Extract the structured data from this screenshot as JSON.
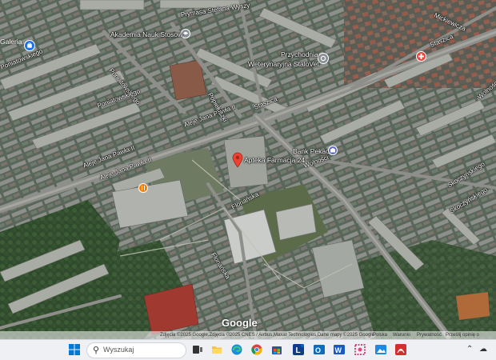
{
  "map": {
    "streets": [
      {
        "id": "aleje-jana-pawla-1",
        "text": "Aleje Jana Pawła II"
      },
      {
        "id": "aleje-jana-pawla-2",
        "text": "Aleje Jana Pawła II"
      },
      {
        "id": "aleje-jana-pawla-3",
        "text": "Aleje Jana Pawła II"
      },
      {
        "id": "poniatowskiego-1",
        "text": "Poniatowskiego"
      },
      {
        "id": "poniatowskiego-2",
        "text": "Poniatowskiego"
      },
      {
        "id": "poniatowskiego-3",
        "text": "Poniatowskiego"
      },
      {
        "id": "prymasa",
        "text": "Prymasa Stefana Wyszy"
      },
      {
        "id": "staszica-1",
        "text": "Staszica"
      },
      {
        "id": "staszica-2",
        "text": "Staszica"
      },
      {
        "id": "mickiewicza",
        "text": "Mickiewicza"
      },
      {
        "id": "wolnosci-1",
        "text": "Wolności"
      },
      {
        "id": "wolnosci-2",
        "text": "Wolności"
      },
      {
        "id": "skoczynskiego-1",
        "text": "Skoczyńskiego"
      },
      {
        "id": "skoczynskiego-2",
        "text": "Skoczyńskiego"
      },
      {
        "id": "florianska-1",
        "text": "Floriańska"
      },
      {
        "id": "florianska-2",
        "text": "Floriańska"
      },
      {
        "id": "popieluszki",
        "text": "Popiełuszki"
      }
    ],
    "pois": {
      "galeria": "Galeria",
      "akademia": "Akademia Nauk Stosow",
      "przychodnia_line1": "Przychodnia",
      "przychodnia_line2": "Weterynaryjna StaloVet",
      "bank": "Bank Pekao",
      "apteka": "Apteka Farmacja 24"
    },
    "brand": "Google",
    "attribution": {
      "main": "Zdjęcia ©2025 Google,Zdjęcia ©2025 CNES / Airbus,Maxar Technologies,Dane mapy ©2025 Google",
      "links": [
        "Polska",
        "Warunki",
        "Prywatność",
        "Prześlij opinię o produkcie"
      ]
    }
  },
  "taskbar": {
    "search_placeholder": "Wyszukaj",
    "colors": {
      "accent": "#0067c0",
      "edge": "#1a8cd8",
      "chrome_red": "#db4437",
      "outlook": "#0f6cbd",
      "word": "#185abd",
      "pdf": "#d32f2f"
    }
  }
}
